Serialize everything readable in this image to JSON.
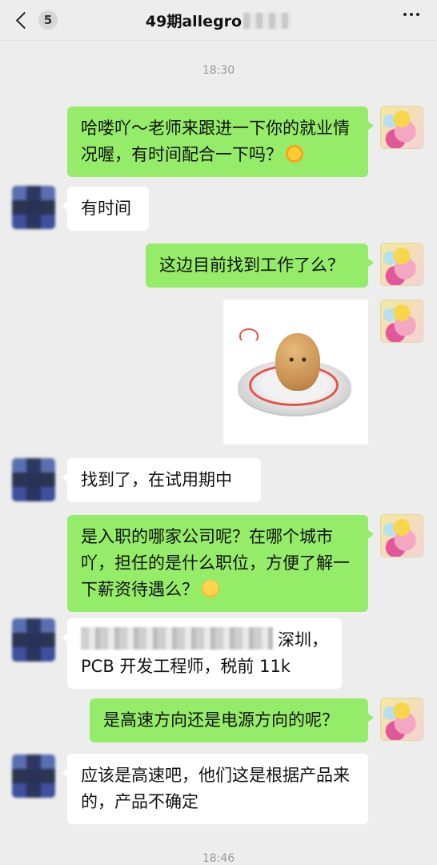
{
  "header": {
    "back_count": "5",
    "title": "49期allegro"
  },
  "timestamps": [
    "18:30",
    "18:46"
  ],
  "messages": [
    {
      "from": "me",
      "text": "哈喽吖～老师来跟进一下你的就业情况喔，有时间配合一下吗？",
      "emoji": "sun-emoji"
    },
    {
      "from": "other",
      "text": "有时间"
    },
    {
      "from": "me",
      "text": "这边目前找到工作了么？"
    },
    {
      "from": "me",
      "type": "sticker",
      "sticker": "potato-heart-sticker"
    },
    {
      "from": "other",
      "text": "找到了，在试用期中"
    },
    {
      "from": "me",
      "text": "是入职的哪家公司呢？在哪个城市吖，担任的是什么职位，方便了解一下薪资待遇么？",
      "emoji": "smile-emoji"
    },
    {
      "from": "other",
      "text_after_redaction": "深圳，PCB 开发工程师，税前 11k"
    },
    {
      "from": "me",
      "text": "是高速方向还是电源方向的呢？"
    },
    {
      "from": "other",
      "text": "应该是高速吧，他们这是根据产品来的，产品不确定"
    }
  ],
  "colors": {
    "background": "#ededed",
    "my_bubble": "#95ec69",
    "their_bubble": "#ffffff"
  }
}
